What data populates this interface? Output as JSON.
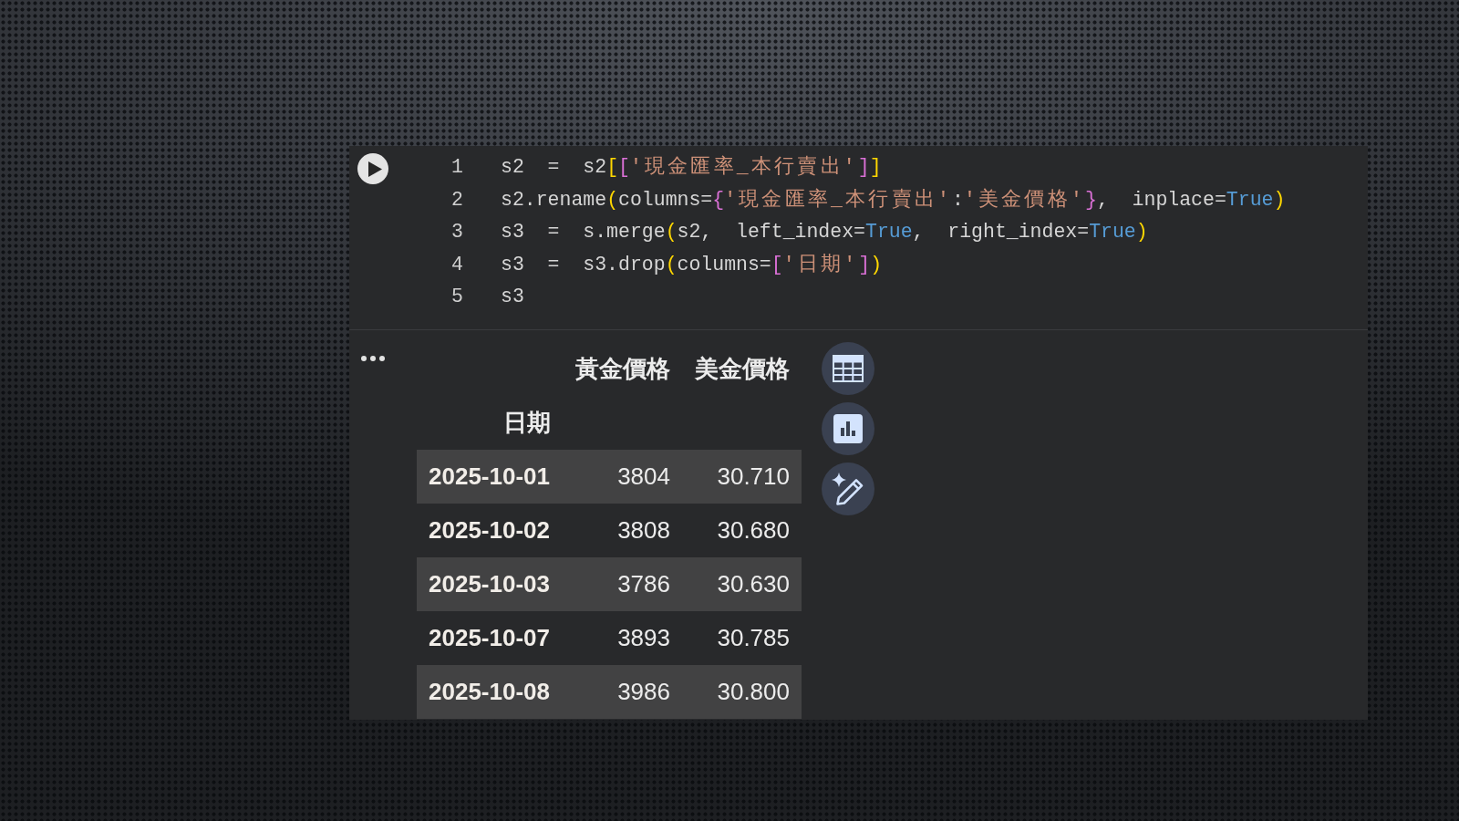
{
  "code_cell": {
    "lines": [
      {
        "number": "1",
        "tokens": [
          {
            "kind": "plain",
            "text": "s2  =  s2"
          },
          {
            "kind": "bracket1",
            "text": "["
          },
          {
            "kind": "bracket2",
            "text": "["
          },
          {
            "kind": "string",
            "text": "'現金匯率_本行賣出'"
          },
          {
            "kind": "bracket2",
            "text": "]"
          },
          {
            "kind": "bracket1",
            "text": "]"
          }
        ]
      },
      {
        "number": "2",
        "tokens": [
          {
            "kind": "plain",
            "text": "s2.rename"
          },
          {
            "kind": "bracket1",
            "text": "("
          },
          {
            "kind": "plain",
            "text": "columns="
          },
          {
            "kind": "bracket2",
            "text": "{"
          },
          {
            "kind": "string",
            "text": "'現金匯率_本行賣出'"
          },
          {
            "kind": "plain",
            "text": ":"
          },
          {
            "kind": "string",
            "text": "'美金價格'"
          },
          {
            "kind": "bracket2",
            "text": "}"
          },
          {
            "kind": "plain",
            "text": ",  inplace="
          },
          {
            "kind": "keyword",
            "text": "True"
          },
          {
            "kind": "bracket1",
            "text": ")"
          }
        ]
      },
      {
        "number": "3",
        "tokens": [
          {
            "kind": "plain",
            "text": "s3  =  s.merge"
          },
          {
            "kind": "bracket1",
            "text": "("
          },
          {
            "kind": "plain",
            "text": "s2,  left_index="
          },
          {
            "kind": "keyword",
            "text": "True"
          },
          {
            "kind": "plain",
            "text": ",  right_index="
          },
          {
            "kind": "keyword",
            "text": "True"
          },
          {
            "kind": "bracket1",
            "text": ")"
          }
        ]
      },
      {
        "number": "4",
        "tokens": [
          {
            "kind": "plain",
            "text": "s3  =  s3.drop"
          },
          {
            "kind": "bracket1",
            "text": "("
          },
          {
            "kind": "plain",
            "text": "columns="
          },
          {
            "kind": "bracket2",
            "text": "["
          },
          {
            "kind": "string",
            "text": "'日期'"
          },
          {
            "kind": "bracket2",
            "text": "]"
          },
          {
            "kind": "bracket1",
            "text": ")"
          }
        ]
      },
      {
        "number": "5",
        "tokens": [
          {
            "kind": "plain",
            "text": "s3"
          }
        ]
      }
    ]
  },
  "output": {
    "table": {
      "columns": [
        "黃金價格",
        "美金價格"
      ],
      "index_name": "日期",
      "rows": [
        {
          "index": "2025-10-01",
          "cells": [
            "3804",
            "30.710"
          ]
        },
        {
          "index": "2025-10-02",
          "cells": [
            "3808",
            "30.680"
          ]
        },
        {
          "index": "2025-10-03",
          "cells": [
            "3786",
            "30.630"
          ]
        },
        {
          "index": "2025-10-07",
          "cells": [
            "3893",
            "30.785"
          ]
        },
        {
          "index": "2025-10-08",
          "cells": [
            "3986",
            "30.800"
          ]
        }
      ]
    }
  }
}
